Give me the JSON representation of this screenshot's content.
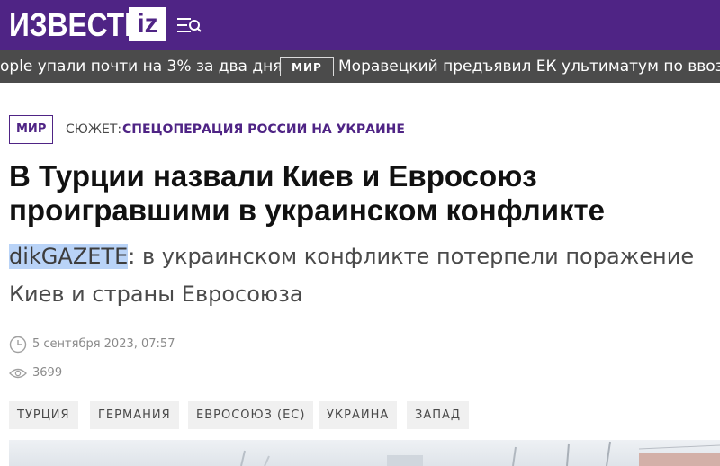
{
  "header": {
    "logo_text": "ИЗВЕСТИЯ",
    "logo_badge": "iz",
    "menu_icon": "menu-search-icon",
    "bg_color": "#4f2485"
  },
  "ticker": {
    "items": [
      {
        "text": "ople упали почти на 3% за два дня"
      },
      {
        "badge": "МИР",
        "text": "Моравецкий предъявил ЕК ультиматум по ввозу з"
      }
    ]
  },
  "article": {
    "section_tag": "МИР",
    "story_label": "СЮЖЕТ:",
    "story_title": "СПЕЦОПЕРАЦИЯ РОССИИ НА УКРАИНЕ",
    "headline": "В Турции назвали Киев и Евросоюз проигравшими в украинском конфликте",
    "lead_highlight": "dikGAZETE",
    "lead_text": ": в украинском конфликте потерпели поражение Киев и страны Евросоюза",
    "date": "5 сентября 2023, 07:57",
    "views": "3699",
    "tags": [
      "ТУРЦИЯ",
      "ГЕРМАНИЯ",
      "ЕВРОСОЮЗ (ЕС)",
      "УКРАИНА",
      "ЗАПАД"
    ]
  }
}
